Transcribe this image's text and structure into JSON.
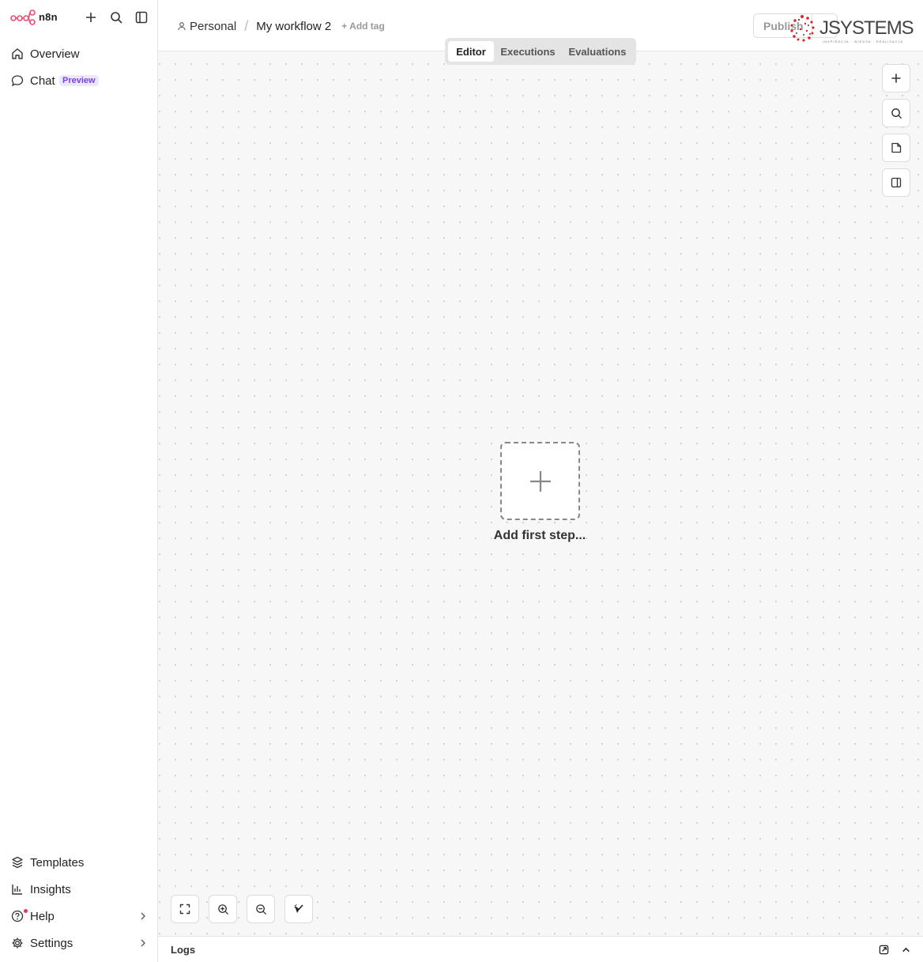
{
  "app": {
    "name": "n8n"
  },
  "sidebar": {
    "top_items": [
      {
        "label": "Overview",
        "icon": "home-icon"
      },
      {
        "label": "Chat",
        "icon": "chat-bubble-icon",
        "badge": "Preview"
      }
    ],
    "bottom_items": [
      {
        "label": "Templates",
        "icon": "templates-box-icon"
      },
      {
        "label": "Insights",
        "icon": "bar-chart-icon"
      },
      {
        "label": "Help",
        "icon": "help-circle-icon",
        "has_chevron": true,
        "notification_dot": true
      },
      {
        "label": "Settings",
        "icon": "gear-icon",
        "has_chevron": true
      }
    ]
  },
  "header": {
    "project": "Personal",
    "separator": "/",
    "workflow_name": "My workflow 2",
    "add_tag": "+ Add tag",
    "publish_label": "Publish",
    "brand_overlay": {
      "text": "JSYSTEMS",
      "tagline": "INSPIRACJA · WIEDZA · REALIZACJA"
    }
  },
  "tabs": [
    {
      "label": "Editor",
      "active": true
    },
    {
      "label": "Executions",
      "active": false
    },
    {
      "label": "Evaluations",
      "active": false
    }
  ],
  "canvas": {
    "add_first_step": "Add first step...",
    "right_tools": [
      "add-node-icon",
      "search-icon",
      "sticky-note-icon",
      "panel-toggle-icon"
    ],
    "zoom_tools": [
      "fit-view-icon",
      "zoom-in-icon",
      "zoom-out-icon",
      "tidy-up-brush-icon"
    ]
  },
  "logs": {
    "label": "Logs"
  },
  "colors": {
    "brand_accent": "#ea4b71",
    "badge_purple": "#7a40e6",
    "brand_red": "#d7262d"
  }
}
